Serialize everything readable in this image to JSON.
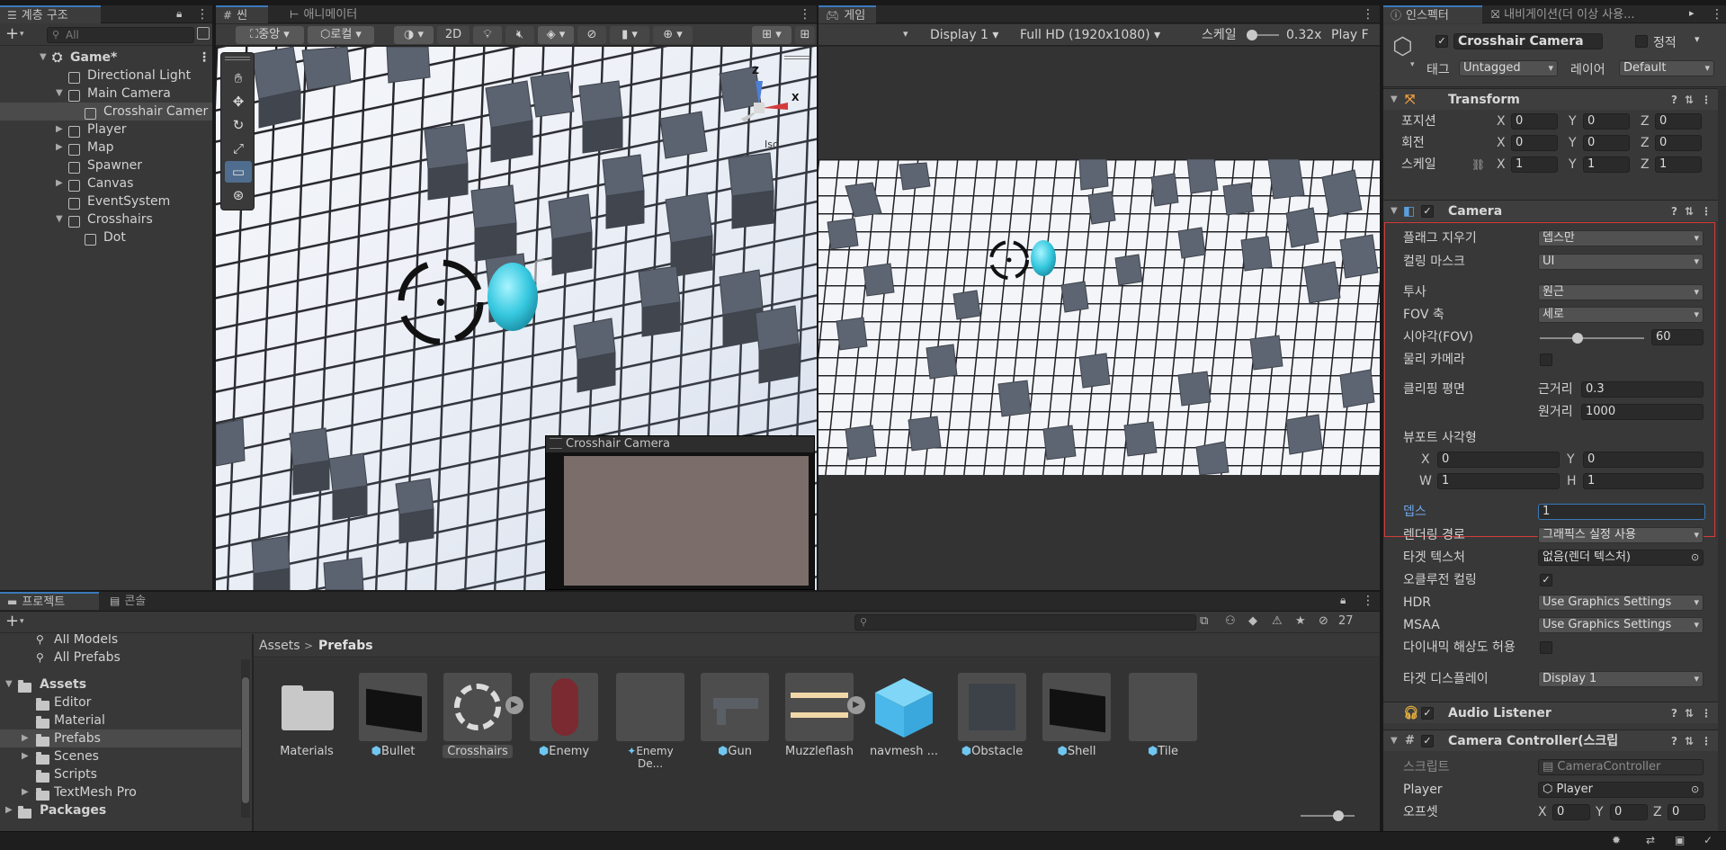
{
  "hierarchy": {
    "tab_label": "계층 구조",
    "search_placeholder": "All",
    "scene_name": "Game*",
    "items": [
      {
        "label": "Directional Light"
      },
      {
        "label": "Main Camera"
      },
      {
        "label": "Crosshair Camer"
      },
      {
        "label": "Player"
      },
      {
        "label": "Map"
      },
      {
        "label": "Spawner"
      },
      {
        "label": "Canvas"
      },
      {
        "label": "EventSystem"
      },
      {
        "label": "Crosshairs"
      },
      {
        "label": "Dot"
      }
    ]
  },
  "scene": {
    "tab_label": "씬",
    "animator_tab_label": "애니메이터",
    "pivot_label": "중앙",
    "space_label": "로컬",
    "mode_2d": "2D",
    "gizmo_persp": "Iso",
    "gizmo_z": "Z",
    "gizmo_x": "X",
    "camera_preview_title": "Crosshair Camera"
  },
  "game": {
    "tab_label": "게임",
    "display": "Display 1",
    "resolution": "Full HD (1920x1080)",
    "scale_label": "스케일",
    "scale_value": "0.32x",
    "play_label": "Play F"
  },
  "inspector": {
    "tab_label": "인스펙터",
    "nav_tab_label": "내비게이션(더 이상 사용...",
    "object_name": "Crosshair Camera",
    "static_label": "정적",
    "tag_label": "태그",
    "tag_value": "Untagged",
    "layer_label": "레이어",
    "layer_value": "Default",
    "transform": {
      "title": "Transform",
      "position_label": "포지션",
      "rotation_label": "회전",
      "scale_label": "스케일",
      "position": [
        "0",
        "0",
        "0"
      ],
      "rotation": [
        "0",
        "0",
        "0"
      ],
      "scale": [
        "1",
        "1",
        "1"
      ],
      "axis_x": "X",
      "axis_y": "Y",
      "axis_z": "Z"
    },
    "camera": {
      "title": "Camera",
      "clear_flags_label": "플래그 지우기",
      "clear_flags_value": "뎁스만",
      "culling_mask_label": "컬링 마스크",
      "culling_mask_value": "UI",
      "projection_label": "투사",
      "projection_value": "원근",
      "fov_axis_label": "FOV 축",
      "fov_axis_value": "세로",
      "fov_label": "시야각(FOV)",
      "fov_value": "60",
      "physical_label": "물리 카메라",
      "clipping_label": "클리핑 평면",
      "near_label": "근거리",
      "near_value": "0.3",
      "far_label": "원거리",
      "far_value": "1000",
      "viewport_label": "뷰포트 사각형",
      "vp_x_label": "X",
      "vp_x": "0",
      "vp_y_label": "Y",
      "vp_y": "0",
      "vp_w_label": "W",
      "vp_w": "1",
      "vp_h_label": "H",
      "vp_h": "1",
      "depth_label": "뎁스",
      "depth_value": "1",
      "render_path_label": "렌더링 경로",
      "render_path_value": "그래픽스 실정 사용",
      "target_tex_label": "타겟 텍스처",
      "target_tex_value": "없음(렌더 텍스처)",
      "occlusion_label": "오클루전 컬링",
      "hdr_label": "HDR",
      "hdr_value": "Use Graphics Settings",
      "msaa_label": "MSAA",
      "msaa_value": "Use Graphics Settings",
      "dyn_res_label": "다이내믹 해상도 허용",
      "target_display_label": "타겟 디스플레이",
      "target_display_value": "Display 1"
    },
    "audio_listener": {
      "title": "Audio Listener"
    },
    "camera_controller": {
      "title": "Camera Controller(스크립",
      "script_label": "스크립트",
      "script_value": "CameraController",
      "player_label": "Player",
      "player_value": "Player",
      "offset_label": "오프셋",
      "offset": [
        "0",
        "0",
        "0"
      ]
    }
  },
  "project": {
    "tab_label": "프로젝트",
    "console_tab_label": "콘솔",
    "hidden_count": "27",
    "tree": [
      {
        "label": "All Models"
      },
      {
        "label": "All Prefabs"
      },
      {
        "label": "Assets"
      },
      {
        "label": "Editor"
      },
      {
        "label": "Material"
      },
      {
        "label": "Prefabs"
      },
      {
        "label": "Scenes"
      },
      {
        "label": "Scripts"
      },
      {
        "label": "TextMesh Pro"
      },
      {
        "label": "Packages"
      }
    ],
    "breadcrumb_root": "Assets",
    "breadcrumb_current": "Prefabs",
    "assets": [
      {
        "label": "Materials"
      },
      {
        "label": "Bullet"
      },
      {
        "label": "Crosshairs"
      },
      {
        "label": "Enemy"
      },
      {
        "label": "Enemy De..."
      },
      {
        "label": "Gun"
      },
      {
        "label": "Muzzleflash"
      },
      {
        "label": "navmesh ..."
      },
      {
        "label": "Obstacle"
      },
      {
        "label": "Shell"
      },
      {
        "label": "Tile"
      }
    ]
  },
  "colors": {
    "accent": "#3a79bb",
    "highlight_border": "#d23b3b",
    "cyan": "#31c9e0"
  }
}
